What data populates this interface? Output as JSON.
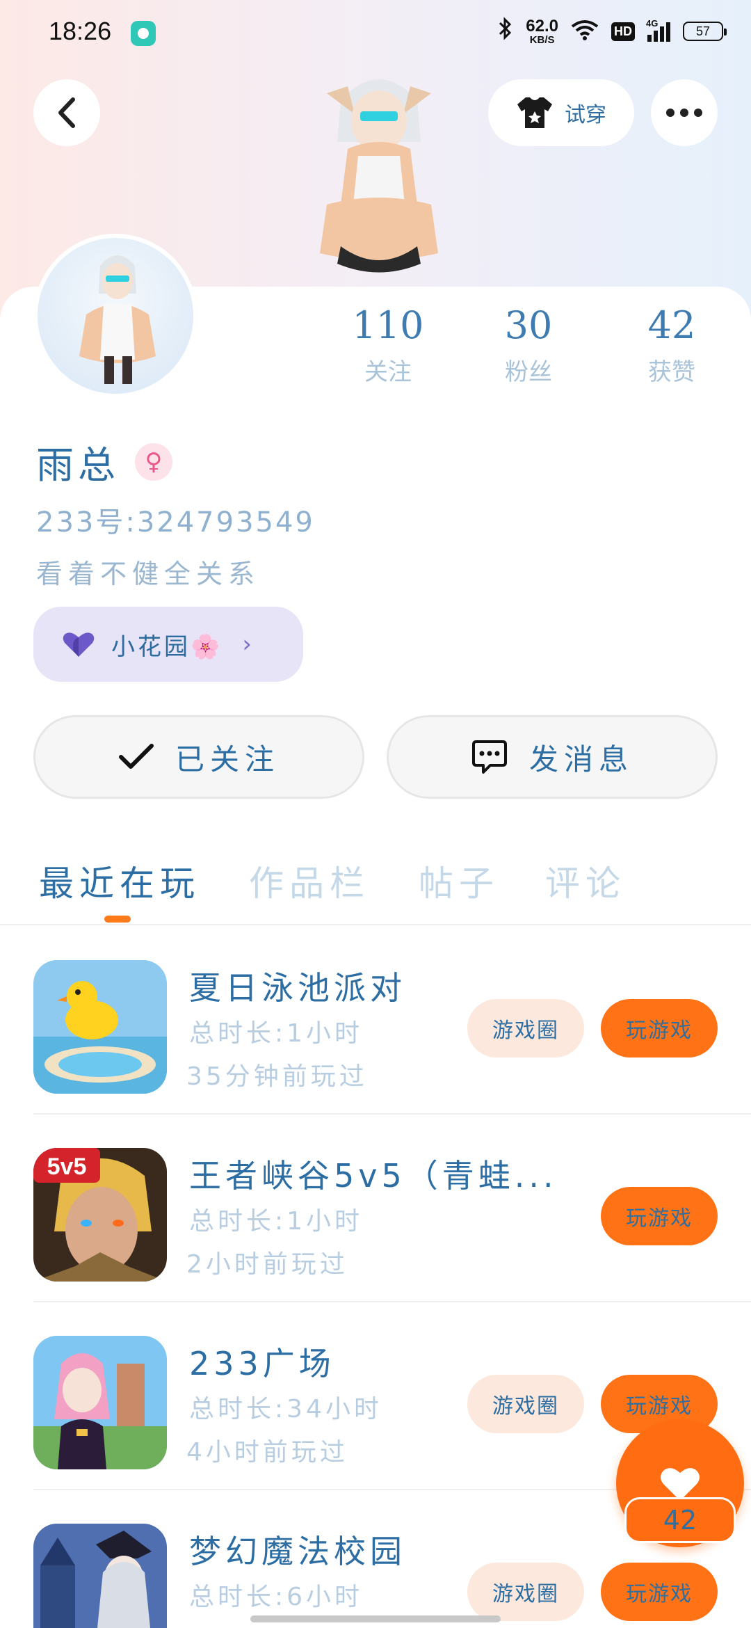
{
  "status_bar": {
    "time": "18:26",
    "net_speed_value": "62.0",
    "net_speed_unit": "KB/S",
    "hd": "HD",
    "network": "4G",
    "battery": "57"
  },
  "header": {
    "try_on_label": "试穿"
  },
  "profile": {
    "stats": [
      {
        "value": "110",
        "label": "关注"
      },
      {
        "value": "30",
        "label": "粉丝"
      },
      {
        "value": "42",
        "label": "获赞"
      }
    ],
    "username": "雨总",
    "gender_symbol": "♀",
    "account_id": "233号:324793549",
    "bio": "看着不健全关系",
    "garden_label": "小花园🌸",
    "follow_label": "已关注",
    "message_label": "发消息"
  },
  "tabs": [
    {
      "label": "最近在玩",
      "active": true
    },
    {
      "label": "作品栏",
      "active": false
    },
    {
      "label": "帖子",
      "active": false
    },
    {
      "label": "评论",
      "active": false
    }
  ],
  "games": [
    {
      "title": "夏日泳池派对",
      "duration": "总时长:1小时",
      "last_played": "35分钟前玩过",
      "has_circle": true
    },
    {
      "title": "王者峡谷5v5（青蛙...",
      "duration": "总时长:1小时",
      "last_played": "2小时前玩过",
      "has_circle": false
    },
    {
      "title": "233广场",
      "duration": "总时长:34小时",
      "last_played": "4小时前玩过",
      "has_circle": true
    },
    {
      "title": "梦幻魔法校园",
      "duration": "总时长:6小时",
      "last_played": "",
      "has_circle": true
    }
  ],
  "game_buttons": {
    "circle_label": "游戏圈",
    "play_label": "玩游戏"
  },
  "game_icon_badge": "5v5",
  "like": {
    "count": "42"
  },
  "colors": {
    "accent": "#ff7316",
    "text_primary": "#2c6ea3",
    "text_muted": "#b8cde0"
  }
}
